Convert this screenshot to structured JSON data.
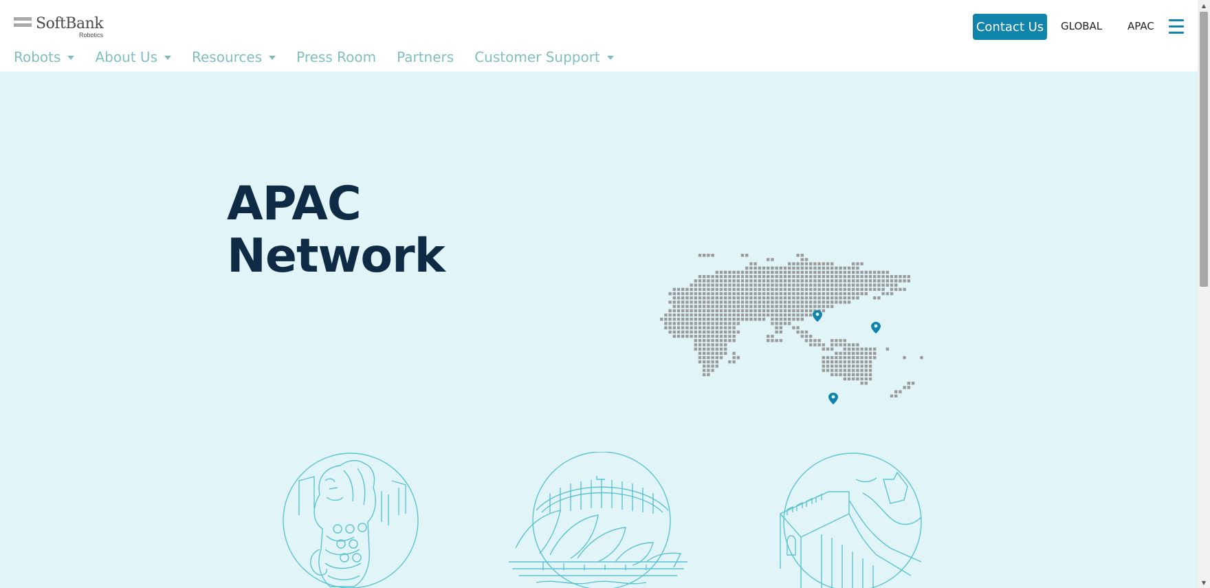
{
  "brand": {
    "name": "SoftBank",
    "sub": "Robotics"
  },
  "header": {
    "contact_label": "Contact Us",
    "global_label": "GLOBAL",
    "region_label": "APAC"
  },
  "nav": [
    {
      "label": "Robots",
      "dropdown": true
    },
    {
      "label": "About Us",
      "dropdown": true
    },
    {
      "label": "Resources",
      "dropdown": true
    },
    {
      "label": "Press Room",
      "dropdown": false
    },
    {
      "label": "Partners",
      "dropdown": false
    },
    {
      "label": "Customer Support",
      "dropdown": true
    }
  ],
  "hero": {
    "title_line1": "APAC",
    "title_line2": "Network"
  },
  "colors": {
    "accent": "#1184ab",
    "nav_text": "#7fbfc0",
    "hero_bg": "#e1f5f8",
    "title": "#0e2a45",
    "map_dot": "#9a9a9a",
    "landmark_line": "#5bc2cf"
  },
  "icons": {
    "menu": "hamburger-icon",
    "map_marker": "location-pin-icon"
  }
}
